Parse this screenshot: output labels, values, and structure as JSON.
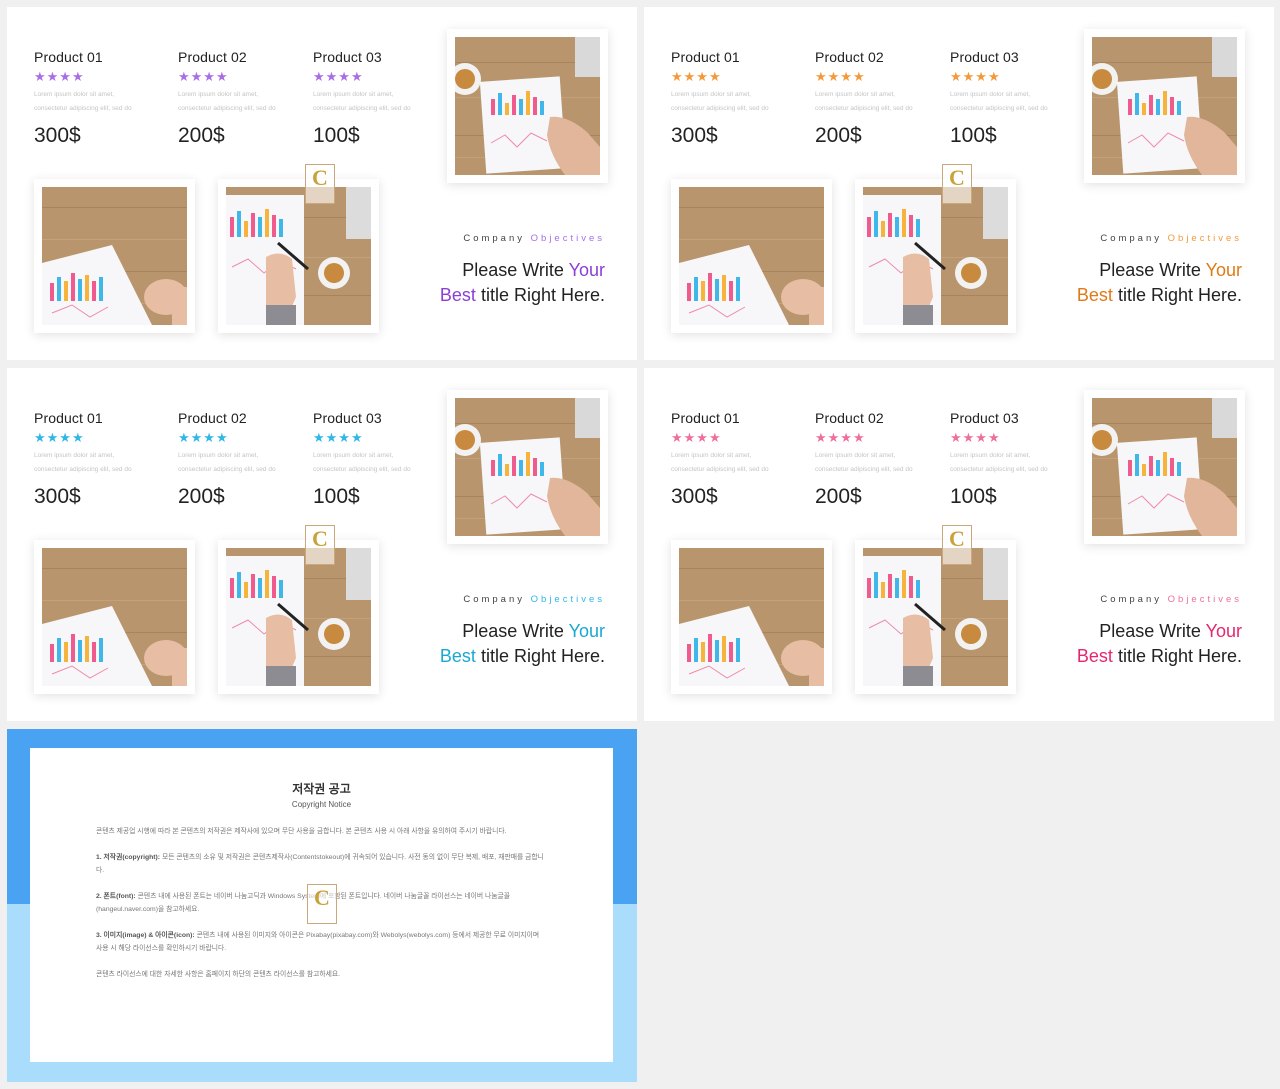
{
  "colors": {
    "slide1_accent": "#8b3fd6",
    "slide2_accent": "#e07a17",
    "slide3_accent": "#1ba8d0",
    "slide4_accent": "#e8266f",
    "star_purple": "#a86ee6",
    "star_orange": "#f29a3a",
    "star_cyan": "#2fb7e6",
    "star_pink": "#ee6f9d"
  },
  "stars": "★★★★",
  "slides": [
    {
      "products": [
        {
          "name": "Product 01",
          "desc1": "Lorem ipsum dolor sit amet,",
          "desc2": "consectetur adipiscing elit, sed do",
          "price": "300$"
        },
        {
          "name": "Product 02",
          "desc1": "Lorem ipsum dolor sit amet,",
          "desc2": "consectetur adipiscing elit, sed do",
          "price": "200$"
        },
        {
          "name": "Product 03",
          "desc1": "Lorem ipsum dolor sit amet,",
          "desc2": "consectetur adipiscing elit, sed do",
          "price": "100$"
        }
      ],
      "objectives_1": "Company",
      "objectives_2": "Objectives",
      "title_a": "Please Write",
      "title_b": "Your",
      "title_c": "Best",
      "title_d": "title Right Here."
    },
    {
      "products": [
        {
          "name": "Product 01",
          "desc1": "Lorem ipsum dolor sit amet,",
          "desc2": "consectetur adipiscing elit, sed do",
          "price": "300$"
        },
        {
          "name": "Product 02",
          "desc1": "Lorem ipsum dolor sit amet,",
          "desc2": "consectetur adipiscing elit, sed do",
          "price": "200$"
        },
        {
          "name": "Product 03",
          "desc1": "Lorem ipsum dolor sit amet,",
          "desc2": "consectetur adipiscing elit, sed do",
          "price": "100$"
        }
      ],
      "objectives_1": "Company",
      "objectives_2": "Objectives",
      "title_a": "Please Write",
      "title_b": "Your",
      "title_c": "Best",
      "title_d": "title Right Here."
    },
    {
      "products": [
        {
          "name": "Product 01",
          "desc1": "Lorem ipsum dolor sit amet,",
          "desc2": "consectetur adipiscing elit, sed do",
          "price": "300$"
        },
        {
          "name": "Product 02",
          "desc1": "Lorem ipsum dolor sit amet,",
          "desc2": "consectetur adipiscing elit, sed do",
          "price": "200$"
        },
        {
          "name": "Product 03",
          "desc1": "Lorem ipsum dolor sit amet,",
          "desc2": "consectetur adipiscing elit, sed do",
          "price": "100$"
        }
      ],
      "objectives_1": "Company",
      "objectives_2": "Objectives",
      "title_a": "Please Write",
      "title_b": "Your",
      "title_c": "Best",
      "title_d": "title Right Here."
    },
    {
      "products": [
        {
          "name": "Product 01",
          "desc1": "Lorem ipsum dolor sit amet,",
          "desc2": "consectetur adipiscing elit, sed do",
          "price": "300$"
        },
        {
          "name": "Product 02",
          "desc1": "Lorem ipsum dolor sit amet,",
          "desc2": "consectetur adipiscing elit, sed do",
          "price": "200$"
        },
        {
          "name": "Product 03",
          "desc1": "Lorem ipsum dolor sit amet,",
          "desc2": "consectetur adipiscing elit, sed do",
          "price": "100$"
        }
      ],
      "objectives_1": "Company",
      "objectives_2": "Objectives",
      "title_a": "Please Write",
      "title_b": "Your",
      "title_c": "Best",
      "title_d": "title Right Here."
    }
  ],
  "logo_letter": "C",
  "notice": {
    "title": "저작권 공고",
    "subtitle": "Copyright Notice",
    "intro": "콘텐츠 제공업 시행에 따라 본 콘텐츠의 저작권은 제작사에 있으며 무단 사용을 금합니다. 본 콘텐츠 사용 시 아래 사항을 유의하여 주시기 바랍니다.",
    "s1_label": "1. 저작권(copyright):",
    "s1_text": "모든 콘텐츠의 소유 및 저작권은 콘텐츠제작사(Contentstokeout)에 귀속되어 있습니다. 사전 동의 없이 무단 복제, 배포, 재판매를 금합니다.",
    "s2_label": "2. 폰트(font):",
    "s2_text": "콘텐츠 내에 사용된 폰트는 네이버 나눔고딕과 Windows System에 포함된 폰트입니다. 네이버 나눔글꼴 라이선스는 네이버 나눔글꼴(hangeul.naver.com)을 참고하세요.",
    "s3_label": "3. 이미지(image) & 아이콘(icon):",
    "s3_text": "콘텐츠 내에 사용된 이미지와 아이콘은 Pixabay(pixabay.com)와 Webolys(webolys.com) 등에서 제공한 무료 이미지이며 사용 시 해당 라이선스를 확인하시기 바랍니다.",
    "outro": "콘텐츠 라이선스에 대한 자세한 사항은 홈페이지 하단의 콘텐츠 라이선스를 참고하세요."
  }
}
